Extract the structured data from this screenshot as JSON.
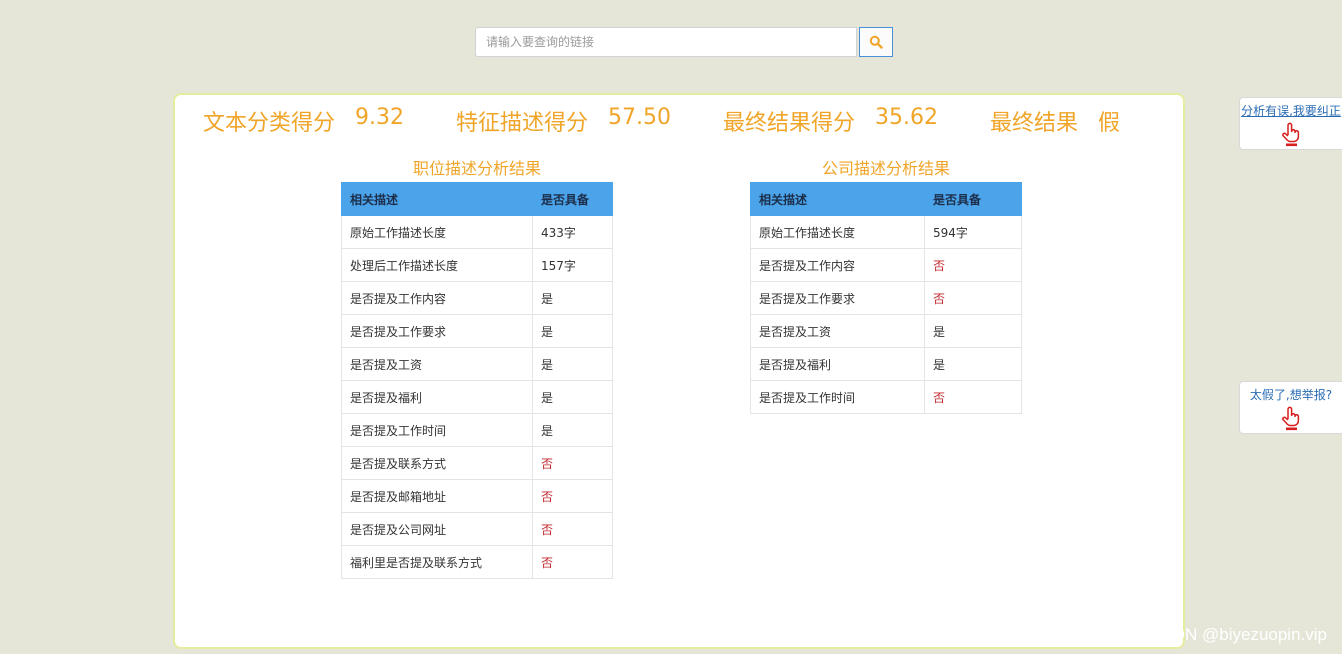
{
  "search": {
    "placeholder": "请输入要查询的链接"
  },
  "scores": {
    "text_label": "文本分类得分",
    "text_value": "9.32",
    "feature_label": "特征描述得分",
    "feature_value": "57.50",
    "final_score_label": "最终结果得分",
    "final_score_value": "35.62",
    "final_result_label": "最终结果",
    "final_result_value": "假"
  },
  "job_section": {
    "title": "职位描述分析结果",
    "headers": [
      "相关描述",
      "是否具备"
    ],
    "rows": [
      [
        "原始工作描述长度",
        "433字"
      ],
      [
        "处理后工作描述长度",
        "157字"
      ],
      [
        "是否提及工作内容",
        "是"
      ],
      [
        "是否提及工作要求",
        "是"
      ],
      [
        "是否提及工资",
        "是"
      ],
      [
        "是否提及福利",
        "是"
      ],
      [
        "是否提及工作时间",
        "是"
      ],
      [
        "是否提及联系方式",
        "否"
      ],
      [
        "是否提及邮箱地址",
        "否"
      ],
      [
        "是否提及公司网址",
        "否"
      ],
      [
        "福利里是否提及联系方式",
        "否"
      ]
    ]
  },
  "company_section": {
    "title": "公司描述分析结果",
    "headers": [
      "相关描述",
      "是否具备"
    ],
    "rows": [
      [
        "原始工作描述长度",
        "594字"
      ],
      [
        "是否提及工作内容",
        "否"
      ],
      [
        "是否提及工作要求",
        "否"
      ],
      [
        "是否提及工资",
        "是"
      ],
      [
        "是否提及福利",
        "是"
      ],
      [
        "是否提及工作时间",
        "否"
      ]
    ]
  },
  "side": {
    "correct_label": "分析有误,我要纠正",
    "report_label": "太假了,想举报?"
  },
  "watermark": "CSDN @biyezuopin.vip",
  "colors": {
    "accent": "#f0a529",
    "header_bg": "#4ba3ea",
    "negative": "#c0282d",
    "page_bg": "#e5e6d8"
  }
}
